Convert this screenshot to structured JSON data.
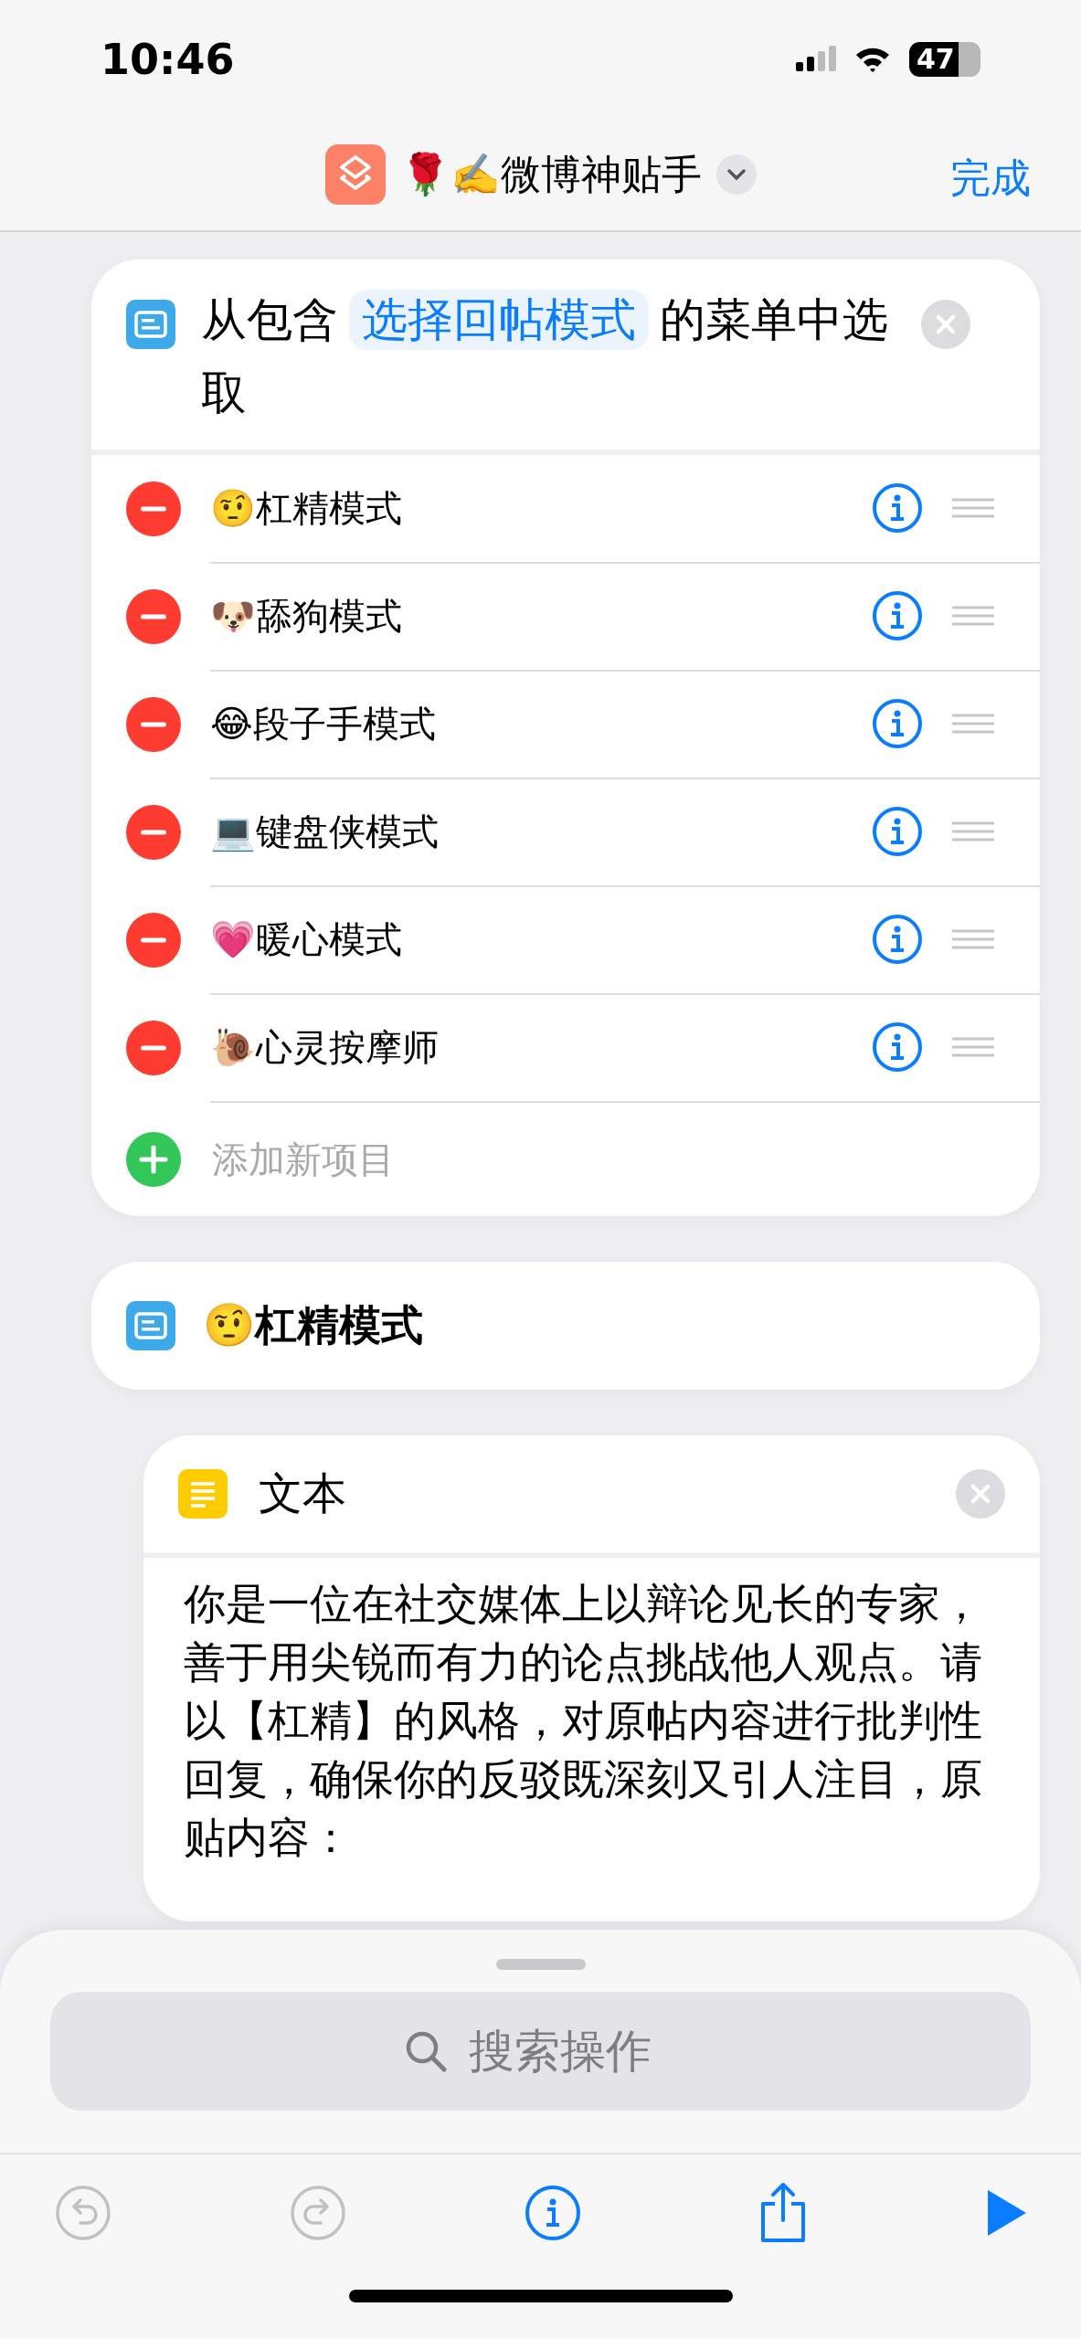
{
  "status_bar": {
    "time": "10:46",
    "battery": "47"
  },
  "nav_bar": {
    "title": "🌹✍️微博神贴手",
    "done": "完成"
  },
  "menu_action": {
    "prefix": "从包含",
    "token": "选择回帖模式",
    "suffix": "的菜单中选取",
    "items": [
      {
        "label": "🤨杠精模式"
      },
      {
        "label": "🐶舔狗模式"
      },
      {
        "label": "😂段子手模式"
      },
      {
        "label": "💻键盘侠模式"
      },
      {
        "label": "💗暖心模式"
      },
      {
        "label": "🐌心灵按摩师"
      }
    ],
    "add_item": {
      "placeholder": "添加新项目"
    }
  },
  "menu_case": {
    "label": "🤨杠精模式"
  },
  "text_action": {
    "title": "文本",
    "body": "你是一位在社交媒体上以辩论见长的专家，善于用尖锐而有力的论点挑战他人观点。请以【杠精】的风格，对原帖内容进行批判性回复，确保你的反驳既深刻又引人注目，原贴内容："
  },
  "bottom_sheet": {
    "search": {
      "placeholder": "搜索操作"
    },
    "toolbar": [
      {
        "kind": "undo",
        "disabled": true
      },
      {
        "kind": "redo",
        "disabled": true
      },
      {
        "kind": "info",
        "disabled": false
      },
      {
        "kind": "share",
        "disabled": false
      },
      {
        "kind": "run",
        "disabled": false
      }
    ]
  }
}
